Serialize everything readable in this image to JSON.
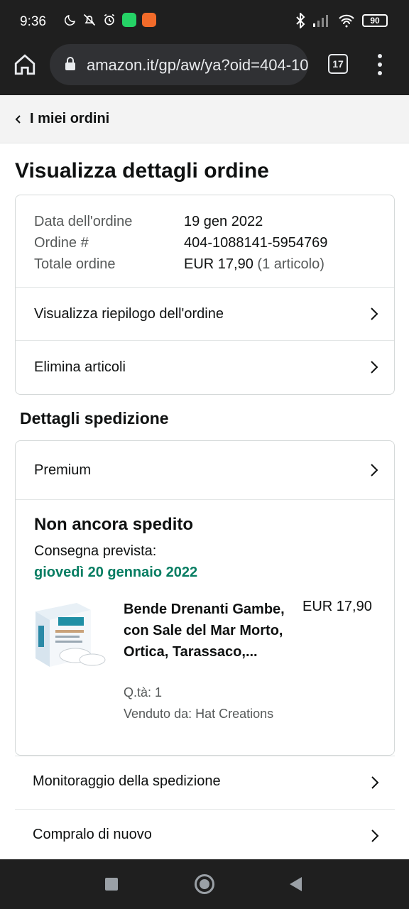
{
  "status_bar": {
    "time": "9:36",
    "battery": "90",
    "icons_left": [
      "moon-icon",
      "mute-icon",
      "alarm-icon",
      "whatsapp-icon",
      "app-icon"
    ],
    "icons_right": [
      "bluetooth-icon",
      "signal-icon",
      "wifi-icon",
      "battery-icon"
    ]
  },
  "browser": {
    "url": "amazon.it/gp/aw/ya?oid=404-1088141-5954769",
    "tab_count": "17"
  },
  "nav": {
    "back_label": "I miei ordini"
  },
  "page": {
    "title": "Visualizza dettagli ordine"
  },
  "order": {
    "date_label": "Data dell'ordine",
    "date_value": "19 gen 2022",
    "number_label": "Ordine #",
    "number_value": "404-1088141-5954769",
    "total_label": "Totale ordine",
    "total_value": "EUR 17,90",
    "total_items": "(1 articolo)",
    "summary_link": "Visualizza riepilogo dell'ordine",
    "delete_link": "Elimina articoli"
  },
  "shipping": {
    "section_title": "Dettagli spedizione",
    "premium_link": "Premium",
    "status": "Non ancora spedito",
    "delivery_label": "Consegna prevista:",
    "delivery_date": "giovedì 20 gennaio 2022",
    "delivery_color": "#067d62"
  },
  "product": {
    "title": "Bende Drenanti Gambe, con Sale del Mar Morto, Ortica, Tarassaco,...",
    "price": "EUR 17,90",
    "qty": "Q.tà: 1",
    "seller": "Venduto da: Hat Creations"
  },
  "actions": {
    "track": "Monitoraggio della spedizione",
    "buy_again": "Compralo di nuovo"
  },
  "colors": {
    "status_bar": "#1f1f1f",
    "nav_bg": "#f3f3f3",
    "text": "#0f1111",
    "muted": "#565959"
  }
}
